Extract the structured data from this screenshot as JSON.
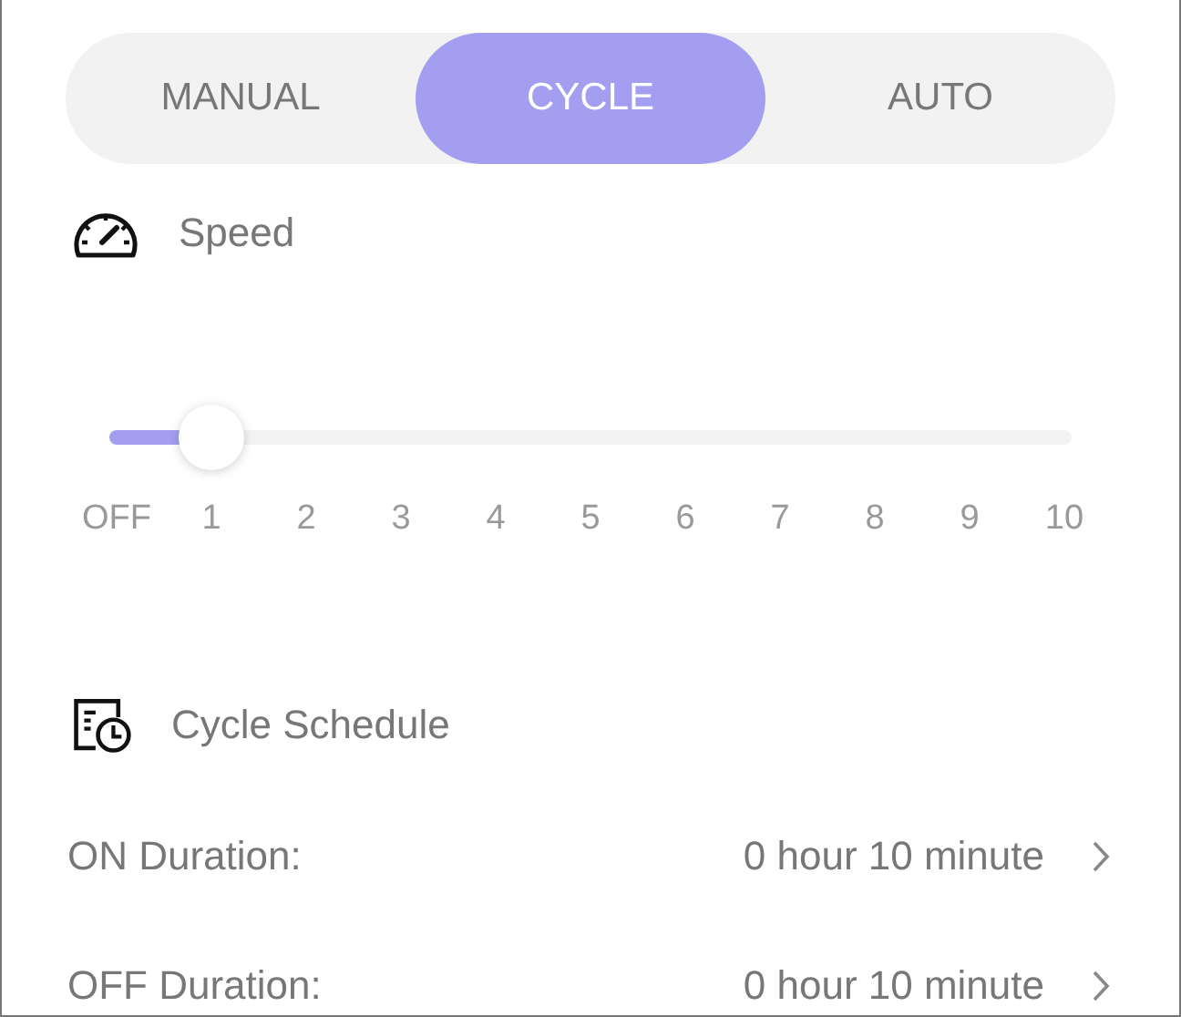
{
  "mode_tabs": [
    {
      "label": "MANUAL",
      "selected": false
    },
    {
      "label": "CYCLE",
      "selected": true
    },
    {
      "label": "AUTO",
      "selected": false
    }
  ],
  "speed": {
    "title": "Speed",
    "level": 0.1,
    "ticks": [
      "OFF",
      "1",
      "2",
      "3",
      "4",
      "5",
      "6",
      "7",
      "8",
      "9",
      "10"
    ]
  },
  "cycle_schedule": {
    "title": "Cycle Schedule",
    "rows": [
      {
        "label": "ON Duration:",
        "value": "0 hour 10 minute"
      },
      {
        "label": "OFF Duration:",
        "value": "0 hour 10 minute"
      }
    ]
  }
}
